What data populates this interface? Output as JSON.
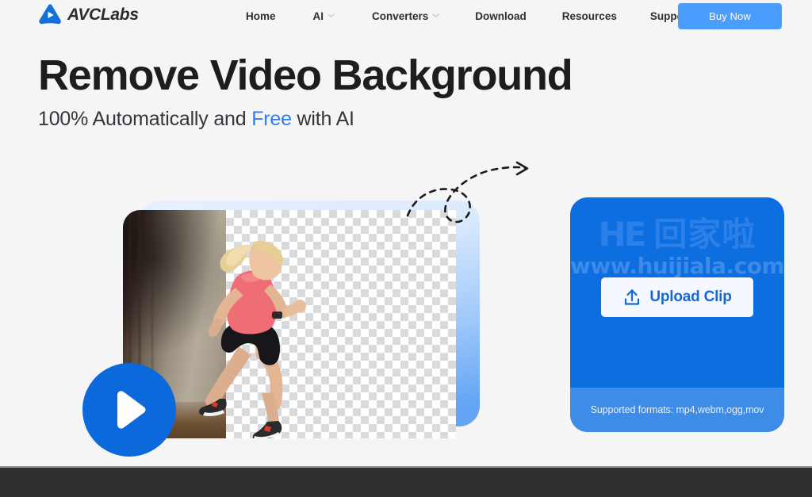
{
  "header": {
    "brand": {
      "logo_icon": "avclabs-play-triangle-logo",
      "name": "AVCLabs"
    },
    "nav": [
      {
        "label": "Home",
        "has_dropdown": false
      },
      {
        "label": "AI",
        "has_dropdown": true
      },
      {
        "label": "Converters",
        "has_dropdown": true
      },
      {
        "label": "Download",
        "has_dropdown": false
      },
      {
        "label": "Resources",
        "has_dropdown": false
      },
      {
        "label": "Support",
        "has_dropdown": false
      }
    ],
    "cta": {
      "label": "Buy Now",
      "color": "#4a9dfc"
    }
  },
  "hero": {
    "title": "Remove Video Background",
    "subtitle_before": "100% Automatically and ",
    "subtitle_accent": "Free",
    "subtitle_after": " with AI",
    "accent_color": "#2f7ef0"
  },
  "preview": {
    "play_icon": "play-button-icon",
    "arrow_icon": "dashed-curved-arrow-icon",
    "left_pane": "original video frame of woman running by concrete wall",
    "right_pane": "background-removed result on transparency checkerboard"
  },
  "upload": {
    "panel_color": "#0d6ee0",
    "button": {
      "label": "Upload Clip",
      "icon": "upload-arrow-icon",
      "text_color": "#1767d8"
    },
    "formats_note": "Supported formats: mp4,webm,ogg,mov",
    "formats_bar_color": "#3d8ce8",
    "watermark": {
      "mark_latin": "H",
      "mark_latin_2": "E",
      "mark_cjk": "回家啦",
      "url": "www.huijiala.com"
    }
  },
  "footer": {
    "strip_color": "#303030"
  }
}
